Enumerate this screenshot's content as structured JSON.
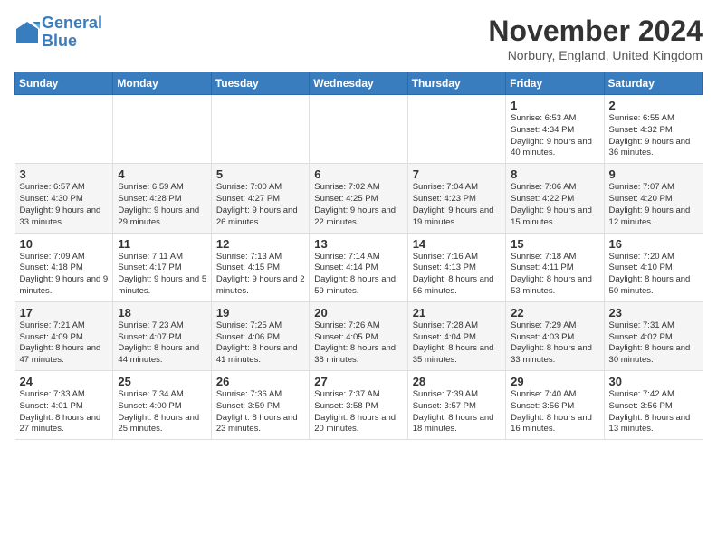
{
  "header": {
    "logo_line1": "General",
    "logo_line2": "Blue",
    "month_title": "November 2024",
    "location": "Norbury, England, United Kingdom"
  },
  "days_of_week": [
    "Sunday",
    "Monday",
    "Tuesday",
    "Wednesday",
    "Thursday",
    "Friday",
    "Saturday"
  ],
  "weeks": [
    [
      {
        "day": "",
        "info": ""
      },
      {
        "day": "",
        "info": ""
      },
      {
        "day": "",
        "info": ""
      },
      {
        "day": "",
        "info": ""
      },
      {
        "day": "",
        "info": ""
      },
      {
        "day": "1",
        "info": "Sunrise: 6:53 AM\nSunset: 4:34 PM\nDaylight: 9 hours\nand 40 minutes."
      },
      {
        "day": "2",
        "info": "Sunrise: 6:55 AM\nSunset: 4:32 PM\nDaylight: 9 hours\nand 36 minutes."
      }
    ],
    [
      {
        "day": "3",
        "info": "Sunrise: 6:57 AM\nSunset: 4:30 PM\nDaylight: 9 hours\nand 33 minutes."
      },
      {
        "day": "4",
        "info": "Sunrise: 6:59 AM\nSunset: 4:28 PM\nDaylight: 9 hours\nand 29 minutes."
      },
      {
        "day": "5",
        "info": "Sunrise: 7:00 AM\nSunset: 4:27 PM\nDaylight: 9 hours\nand 26 minutes."
      },
      {
        "day": "6",
        "info": "Sunrise: 7:02 AM\nSunset: 4:25 PM\nDaylight: 9 hours\nand 22 minutes."
      },
      {
        "day": "7",
        "info": "Sunrise: 7:04 AM\nSunset: 4:23 PM\nDaylight: 9 hours\nand 19 minutes."
      },
      {
        "day": "8",
        "info": "Sunrise: 7:06 AM\nSunset: 4:22 PM\nDaylight: 9 hours\nand 15 minutes."
      },
      {
        "day": "9",
        "info": "Sunrise: 7:07 AM\nSunset: 4:20 PM\nDaylight: 9 hours\nand 12 minutes."
      }
    ],
    [
      {
        "day": "10",
        "info": "Sunrise: 7:09 AM\nSunset: 4:18 PM\nDaylight: 9 hours\nand 9 minutes."
      },
      {
        "day": "11",
        "info": "Sunrise: 7:11 AM\nSunset: 4:17 PM\nDaylight: 9 hours\nand 5 minutes."
      },
      {
        "day": "12",
        "info": "Sunrise: 7:13 AM\nSunset: 4:15 PM\nDaylight: 9 hours\nand 2 minutes."
      },
      {
        "day": "13",
        "info": "Sunrise: 7:14 AM\nSunset: 4:14 PM\nDaylight: 8 hours\nand 59 minutes."
      },
      {
        "day": "14",
        "info": "Sunrise: 7:16 AM\nSunset: 4:13 PM\nDaylight: 8 hours\nand 56 minutes."
      },
      {
        "day": "15",
        "info": "Sunrise: 7:18 AM\nSunset: 4:11 PM\nDaylight: 8 hours\nand 53 minutes."
      },
      {
        "day": "16",
        "info": "Sunrise: 7:20 AM\nSunset: 4:10 PM\nDaylight: 8 hours\nand 50 minutes."
      }
    ],
    [
      {
        "day": "17",
        "info": "Sunrise: 7:21 AM\nSunset: 4:09 PM\nDaylight: 8 hours\nand 47 minutes."
      },
      {
        "day": "18",
        "info": "Sunrise: 7:23 AM\nSunset: 4:07 PM\nDaylight: 8 hours\nand 44 minutes."
      },
      {
        "day": "19",
        "info": "Sunrise: 7:25 AM\nSunset: 4:06 PM\nDaylight: 8 hours\nand 41 minutes."
      },
      {
        "day": "20",
        "info": "Sunrise: 7:26 AM\nSunset: 4:05 PM\nDaylight: 8 hours\nand 38 minutes."
      },
      {
        "day": "21",
        "info": "Sunrise: 7:28 AM\nSunset: 4:04 PM\nDaylight: 8 hours\nand 35 minutes."
      },
      {
        "day": "22",
        "info": "Sunrise: 7:29 AM\nSunset: 4:03 PM\nDaylight: 8 hours\nand 33 minutes."
      },
      {
        "day": "23",
        "info": "Sunrise: 7:31 AM\nSunset: 4:02 PM\nDaylight: 8 hours\nand 30 minutes."
      }
    ],
    [
      {
        "day": "24",
        "info": "Sunrise: 7:33 AM\nSunset: 4:01 PM\nDaylight: 8 hours\nand 27 minutes."
      },
      {
        "day": "25",
        "info": "Sunrise: 7:34 AM\nSunset: 4:00 PM\nDaylight: 8 hours\nand 25 minutes."
      },
      {
        "day": "26",
        "info": "Sunrise: 7:36 AM\nSunset: 3:59 PM\nDaylight: 8 hours\nand 23 minutes."
      },
      {
        "day": "27",
        "info": "Sunrise: 7:37 AM\nSunset: 3:58 PM\nDaylight: 8 hours\nand 20 minutes."
      },
      {
        "day": "28",
        "info": "Sunrise: 7:39 AM\nSunset: 3:57 PM\nDaylight: 8 hours\nand 18 minutes."
      },
      {
        "day": "29",
        "info": "Sunrise: 7:40 AM\nSunset: 3:56 PM\nDaylight: 8 hours\nand 16 minutes."
      },
      {
        "day": "30",
        "info": "Sunrise: 7:42 AM\nSunset: 3:56 PM\nDaylight: 8 hours\nand 13 minutes."
      }
    ]
  ]
}
